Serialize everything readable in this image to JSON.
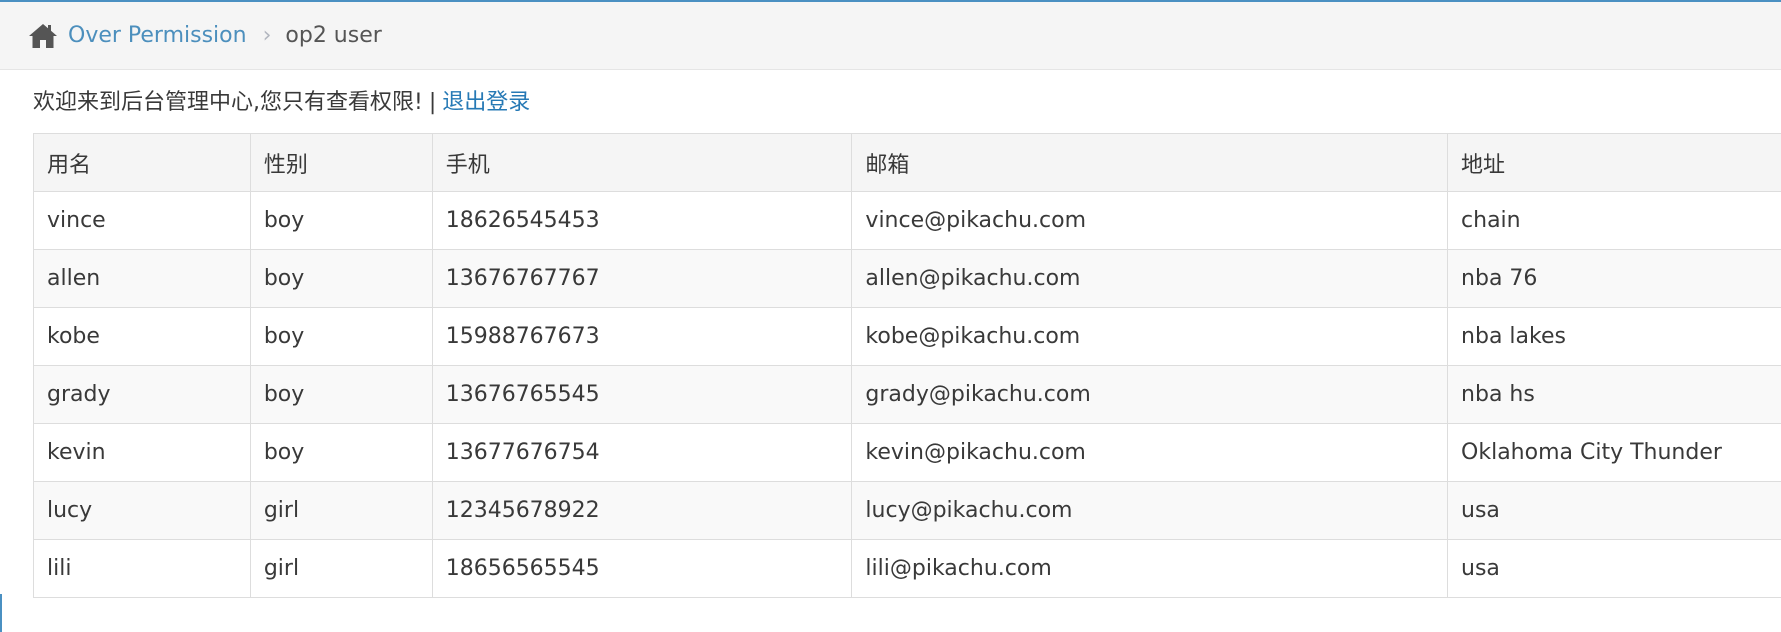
{
  "breadcrumb": {
    "home_icon": "home-icon",
    "link_label": "Over Permission",
    "separator": "›",
    "current_label": "op2 user"
  },
  "welcome": {
    "message": "欢迎来到后台管理中心,您只有查看权限!",
    "separator": "|",
    "logout_label": "退出登录"
  },
  "colors": {
    "accent": "#4a90c2",
    "link": "#2679b5",
    "header_bg": "#f5f5f5"
  },
  "table": {
    "headers": [
      "用名",
      "性别",
      "手机",
      "邮箱",
      "地址"
    ],
    "rows": [
      [
        "vince",
        "boy",
        "18626545453",
        "vince@pikachu.com",
        "chain"
      ],
      [
        "allen",
        "boy",
        "13676767767",
        "allen@pikachu.com",
        "nba 76"
      ],
      [
        "kobe",
        "boy",
        "15988767673",
        "kobe@pikachu.com",
        "nba lakes"
      ],
      [
        "grady",
        "boy",
        "13676765545",
        "grady@pikachu.com",
        "nba hs"
      ],
      [
        "kevin",
        "boy",
        "13677676754",
        "kevin@pikachu.com",
        "Oklahoma City Thunder"
      ],
      [
        "lucy",
        "girl",
        "12345678922",
        "lucy@pikachu.com",
        "usa"
      ],
      [
        "lili",
        "girl",
        "18656565545",
        "lili@pikachu.com",
        "usa"
      ]
    ]
  }
}
